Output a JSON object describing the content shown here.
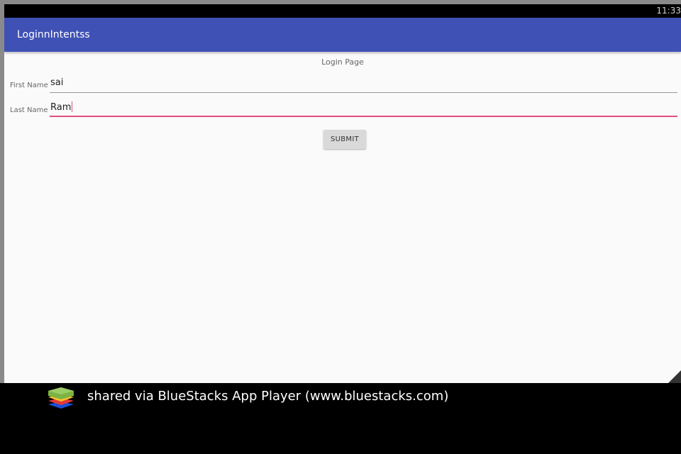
{
  "status_bar": {
    "time": "11:33"
  },
  "app_bar": {
    "title": "LoginnIntentss"
  },
  "login": {
    "heading": "Login Page",
    "first_name": {
      "label": "First Name",
      "value": "sai"
    },
    "last_name": {
      "label": "Last Name",
      "value": "Ram"
    },
    "submit_label": "SUBMIT"
  },
  "footer": {
    "text": "shared via BlueStacks App Player (www.bluestacks.com)"
  },
  "colors": {
    "app_bar": "#3f51b5",
    "focus_accent": "#e0507a",
    "background": "#fafafa"
  }
}
